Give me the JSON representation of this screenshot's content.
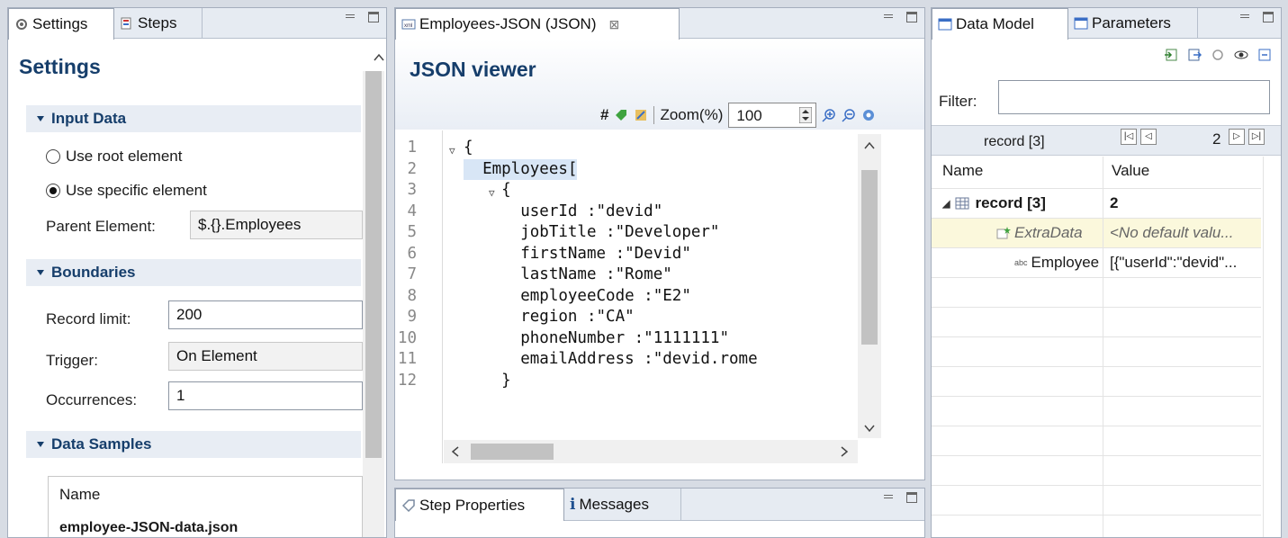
{
  "left_panel": {
    "tabs": [
      {
        "label": "Settings",
        "icon": "settings-icon"
      },
      {
        "label": "Steps",
        "icon": "steps-icon"
      }
    ],
    "title": "Settings",
    "input_data": {
      "header": "Input Data",
      "radio_root": "Use root element",
      "radio_specific": "Use specific element",
      "selected": "specific",
      "parent_label": "Parent Element:",
      "parent_value": "$.{}.Employees"
    },
    "boundaries": {
      "header": "Boundaries",
      "record_limit_label": "Record limit:",
      "record_limit_value": "200",
      "trigger_label": "Trigger:",
      "trigger_value": "On Element",
      "occurrences_label": "Occurrences:",
      "occurrences_value": "1"
    },
    "data_samples": {
      "header": "Data Samples",
      "col_name": "Name",
      "file": "employee-JSON-data.json"
    }
  },
  "center_panel": {
    "tab_label": "Employees-JSON (JSON)",
    "title": "JSON viewer",
    "toolbar": {
      "hash": "#",
      "zoom_label": "Zoom(%)",
      "zoom_value": "100"
    },
    "code_lines": [
      {
        "n": "1",
        "text": "{",
        "fold": true
      },
      {
        "n": "2",
        "text": "  Employees[",
        "fold": true
      },
      {
        "n": "3",
        "text": "    {",
        "fold": true
      },
      {
        "n": "4",
        "text": "      userId :\"devid\""
      },
      {
        "n": "5",
        "text": "      jobTitle :\"Developer\""
      },
      {
        "n": "6",
        "text": "      firstName :\"Devid\""
      },
      {
        "n": "7",
        "text": "      lastName :\"Rome\""
      },
      {
        "n": "8",
        "text": "      employeeCode :\"E2\""
      },
      {
        "n": "9",
        "text": "      region :\"CA\""
      },
      {
        "n": "10",
        "text": "      phoneNumber :\"1111111\""
      },
      {
        "n": "11",
        "text": "      emailAddress :\"devid.romе"
      },
      {
        "n": "12",
        "text": "    }"
      }
    ]
  },
  "bottom_panel": {
    "tabs": [
      {
        "label": "Step Properties",
        "icon": "tag-icon"
      },
      {
        "label": "Messages",
        "icon": "info-icon"
      }
    ]
  },
  "right_panel": {
    "tabs": [
      {
        "label": "Data Model",
        "icon": "data-model-icon"
      },
      {
        "label": "Parameters",
        "icon": "parameters-icon"
      }
    ],
    "filter_label": "Filter:",
    "filter_value": "",
    "record_nav": {
      "label": "record [3]",
      "page": "2"
    },
    "columns": {
      "name": "Name",
      "value": "Value"
    },
    "rows": [
      {
        "name": "record [3]",
        "value": "2"
      },
      {
        "name": "ExtraData",
        "value": "<No default valu..."
      },
      {
        "name": "Employee",
        "value": "[{\"userId\":\"devid\"..."
      }
    ]
  }
}
